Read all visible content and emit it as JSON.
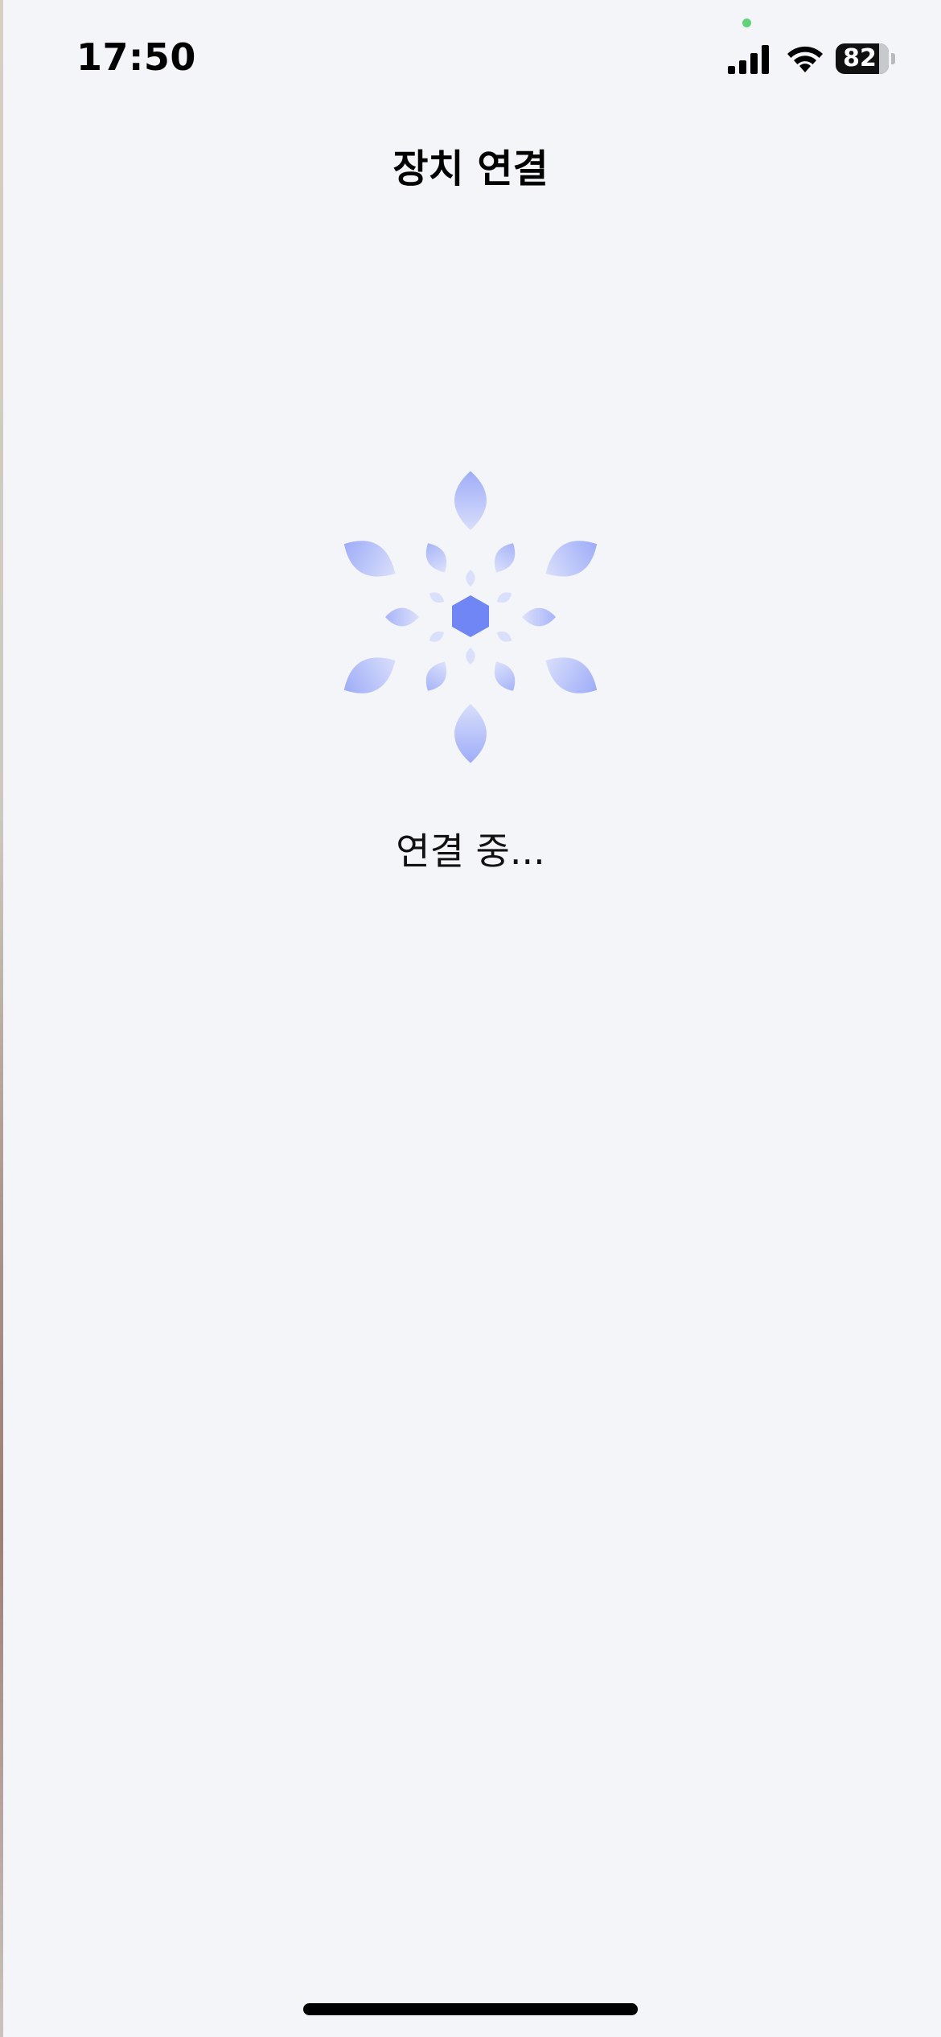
{
  "status_bar": {
    "time": "17:50",
    "battery_percent": "82",
    "battery_level": 0.82,
    "icons": [
      "signal-icon",
      "wifi-icon",
      "battery-icon"
    ],
    "privacy_dot_color": "#5fd37a"
  },
  "nav": {
    "title": "장치 연결"
  },
  "loader": {
    "icon": "loading-spinner-icon",
    "center_color": "#6f86f4",
    "petal_color": "#9aa9f8",
    "petal_light_color": "#d7ddfb"
  },
  "status": {
    "message": "연결 중..."
  },
  "colors": {
    "background": "#f3f5f8",
    "home_indicator": "#000000"
  }
}
